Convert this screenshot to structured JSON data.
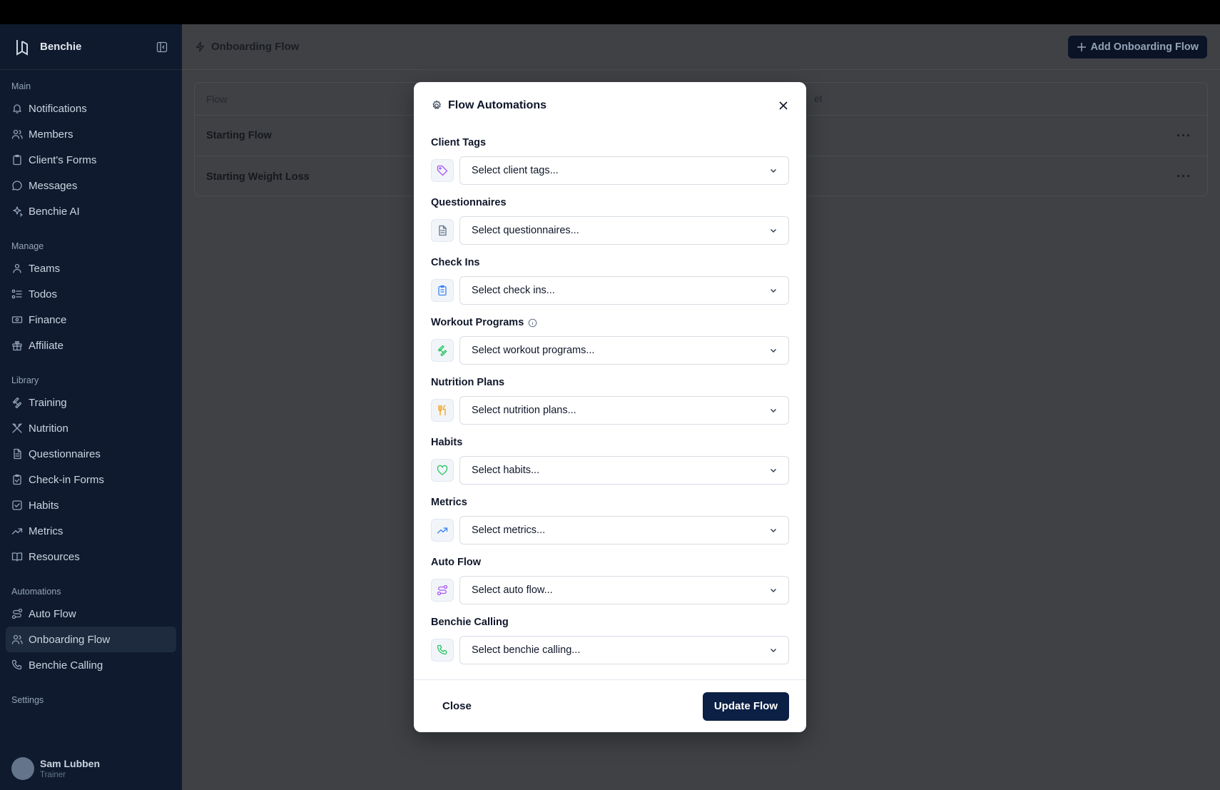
{
  "sidebar": {
    "brand": "Benchie",
    "sections": [
      {
        "title": "Main",
        "items": [
          {
            "label": "Notifications",
            "icon": "bell-icon"
          },
          {
            "label": "Members",
            "icon": "users-icon"
          },
          {
            "label": "Client's Forms",
            "icon": "clipboard-icon"
          },
          {
            "label": "Messages",
            "icon": "message-icon"
          },
          {
            "label": "Benchie AI",
            "icon": "sparkles-icon"
          }
        ]
      },
      {
        "title": "Manage",
        "items": [
          {
            "label": "Teams",
            "icon": "team-icon"
          },
          {
            "label": "Todos",
            "icon": "list-todo-icon"
          },
          {
            "label": "Finance",
            "icon": "banknote-icon"
          },
          {
            "label": "Affiliate",
            "icon": "gift-icon"
          }
        ]
      },
      {
        "title": "Library",
        "items": [
          {
            "label": "Training",
            "icon": "dumbbell-icon"
          },
          {
            "label": "Nutrition",
            "icon": "utensils-crossed-icon"
          },
          {
            "label": "Questionnaires",
            "icon": "file-text-icon"
          },
          {
            "label": "Check-in Forms",
            "icon": "clipboard-check-icon"
          },
          {
            "label": "Habits",
            "icon": "square-check-icon"
          },
          {
            "label": "Metrics",
            "icon": "trending-up-icon"
          },
          {
            "label": "Resources",
            "icon": "book-open-icon"
          }
        ]
      },
      {
        "title": "Automations",
        "items": [
          {
            "label": "Auto Flow",
            "icon": "route-icon"
          },
          {
            "label": "Onboarding Flow",
            "icon": "user-flow-icon",
            "active": true
          },
          {
            "label": "Benchie Calling",
            "icon": "phone-icon"
          }
        ]
      },
      {
        "title": "Settings",
        "items": []
      }
    ],
    "user": {
      "name": "Sam Lubben",
      "role": "Trainer"
    }
  },
  "main": {
    "title": "Onboarding Flow",
    "add_button": "Add Onboarding Flow",
    "table": {
      "columns": [
        "Flow",
        "et"
      ],
      "rows": [
        "Starting Flow",
        "Starting Weight Loss"
      ]
    }
  },
  "modal": {
    "title": "Flow Automations",
    "fields": [
      {
        "label": "Client Tags",
        "placeholder": "Select client tags...",
        "icon": "tag-icon",
        "color": "#a855f7"
      },
      {
        "label": "Questionnaires",
        "placeholder": "Select questionnaires...",
        "icon": "file-text-icon",
        "color": "#64748b"
      },
      {
        "label": "Check Ins",
        "placeholder": "Select check ins...",
        "icon": "clipboard-list-icon",
        "color": "#3b82f6"
      },
      {
        "label": "Workout Programs",
        "placeholder": "Select workout programs...",
        "icon": "dumbbell-icon",
        "color": "#22c55e",
        "info": true
      },
      {
        "label": "Nutrition Plans",
        "placeholder": "Select nutrition plans...",
        "icon": "utensils-icon",
        "color": "#f59e0b"
      },
      {
        "label": "Habits",
        "placeholder": "Select habits...",
        "icon": "heart-icon",
        "color": "#22c55e"
      },
      {
        "label": "Metrics",
        "placeholder": "Select metrics...",
        "icon": "trending-up-icon",
        "color": "#3b82f6"
      },
      {
        "label": "Auto Flow",
        "placeholder": "Select auto flow...",
        "icon": "route-icon",
        "color": "#a855f7"
      },
      {
        "label": "Benchie Calling",
        "placeholder": "Select benchie calling...",
        "icon": "phone-icon",
        "color": "#22c55e"
      }
    ],
    "close_label": "Close",
    "update_label": "Update Flow"
  }
}
